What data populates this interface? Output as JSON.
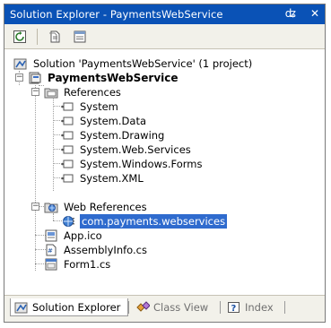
{
  "window": {
    "title": "Solution Explorer - PaymentsWebService",
    "pin_icon": "pin-icon",
    "close_icon": "close-icon"
  },
  "toolbar": {
    "buttons": [
      {
        "icon": "refresh-icon"
      },
      {
        "icon": "show-all-files-icon"
      },
      {
        "icon": "properties-icon"
      }
    ]
  },
  "tree": {
    "solution": "Solution 'PaymentsWebService' (1 project)",
    "project": "PaymentsWebService",
    "references": {
      "label": "References",
      "items": [
        "System",
        "System.Data",
        "System.Drawing",
        "System.Web.Services",
        "System.Windows.Forms",
        "System.XML"
      ]
    },
    "web_references": {
      "label": "Web References",
      "items": [
        "com.payments.webservices"
      ]
    },
    "files": [
      "App.ico",
      "AssemblyInfo.cs",
      "Form1.cs"
    ]
  },
  "tabs": [
    {
      "label": "Solution Explorer",
      "icon": "solution-explorer-icon",
      "active": true
    },
    {
      "label": "Class View",
      "icon": "class-view-icon",
      "active": false
    },
    {
      "label": "Index",
      "icon": "help-index-icon",
      "active": false
    }
  ]
}
